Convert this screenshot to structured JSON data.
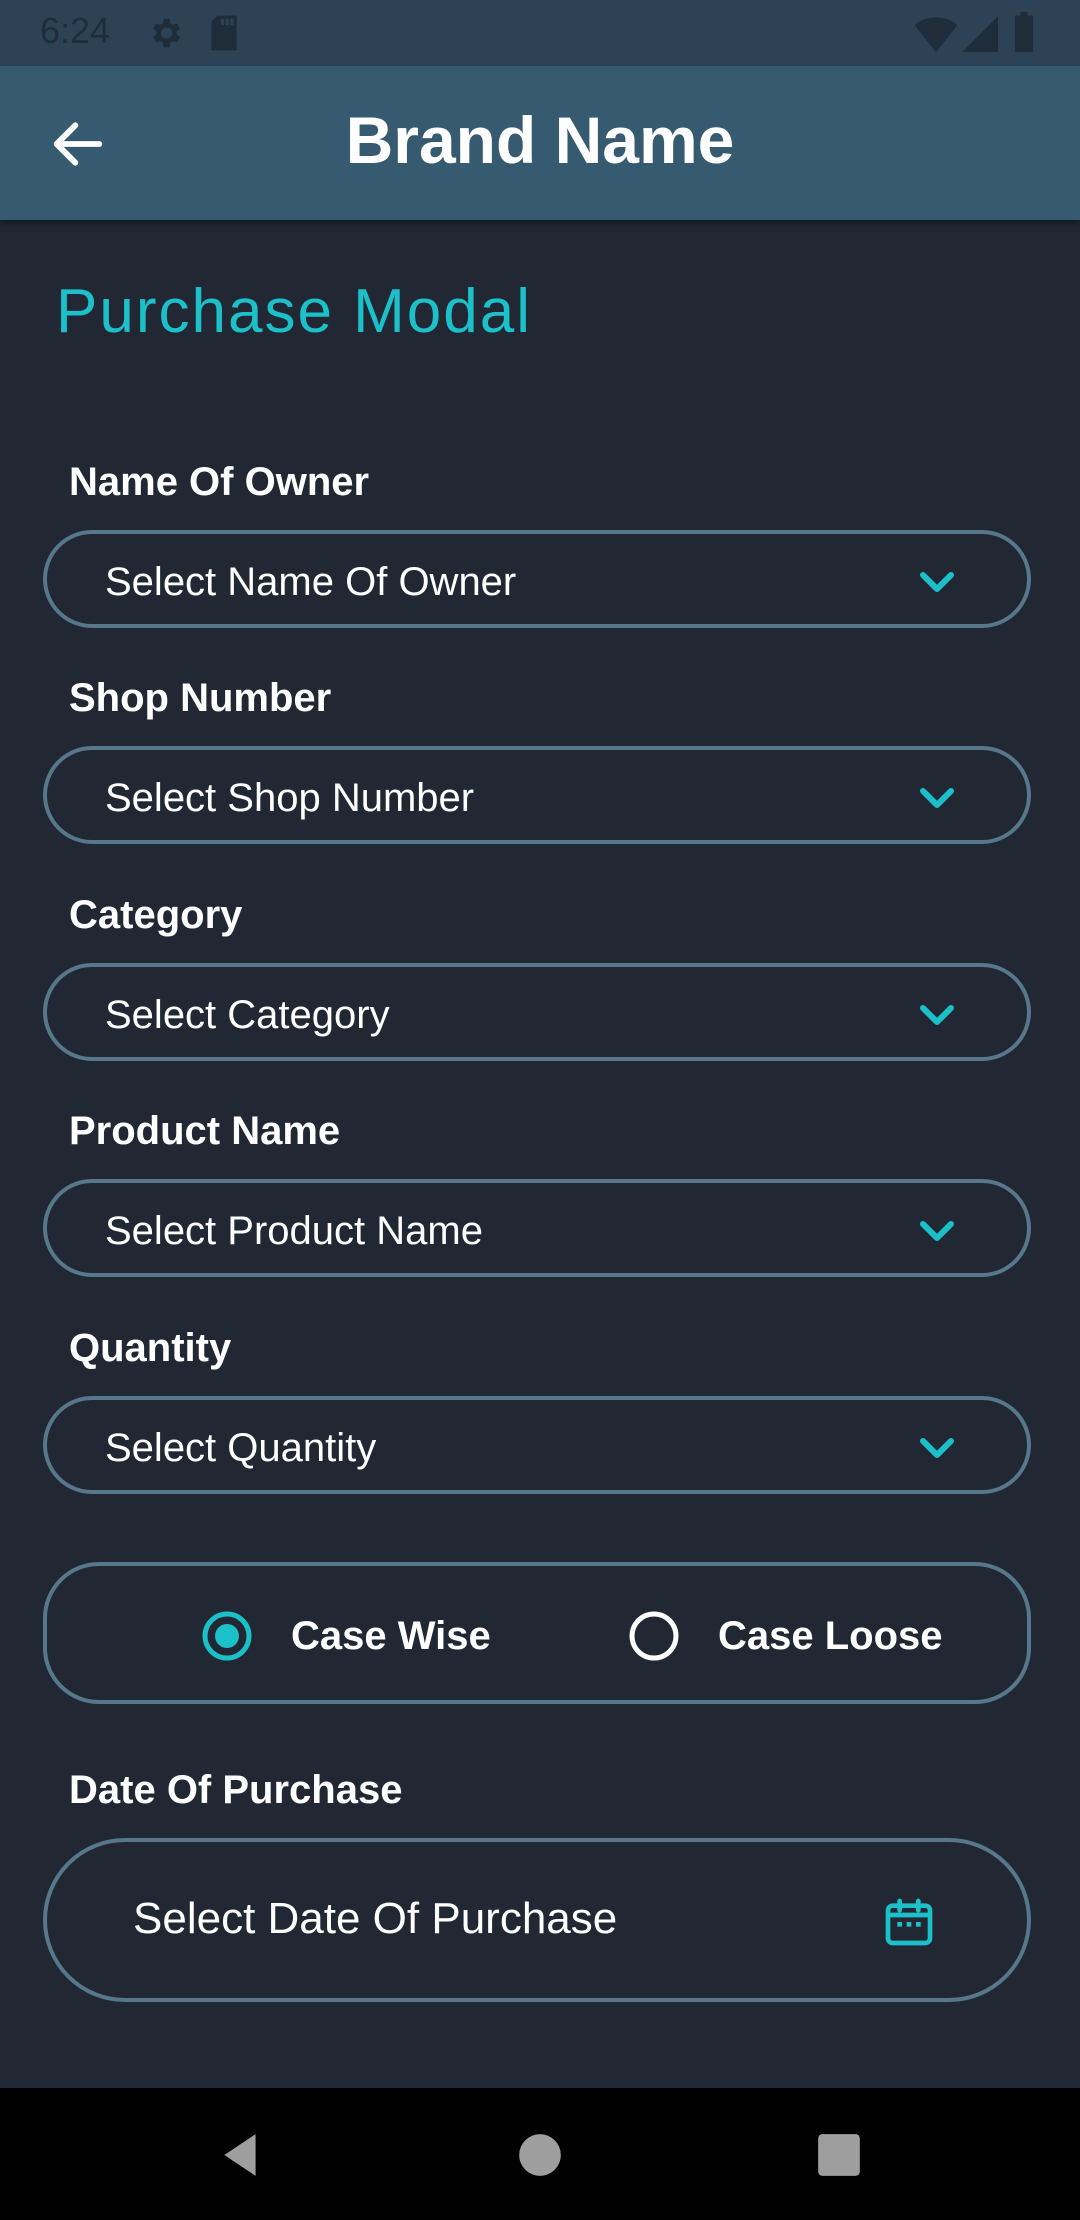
{
  "status_bar": {
    "time": "6:24",
    "icons": [
      "gear-icon",
      "sd-card-icon",
      "wifi-icon",
      "signal-icon",
      "battery-icon"
    ]
  },
  "app_bar": {
    "title": "Brand Name",
    "back_icon": "arrow-back-icon"
  },
  "page": {
    "heading": "Purchase Modal"
  },
  "fields": [
    {
      "label": "Name Of Owner",
      "placeholder": "Select Name Of Owner"
    },
    {
      "label": "Shop Number",
      "placeholder": "Select Shop Number"
    },
    {
      "label": "Category",
      "placeholder": "Select Category"
    },
    {
      "label": "Product Name",
      "placeholder": "Select Product Name"
    },
    {
      "label": "Quantity",
      "placeholder": "Select Quantity"
    }
  ],
  "radio": {
    "options": [
      {
        "label": "Case Wise",
        "selected": true
      },
      {
        "label": "Case Loose",
        "selected": false
      }
    ]
  },
  "date": {
    "label": "Date Of Purchase",
    "placeholder": "Select Date Of Purchase",
    "icon": "calendar-icon"
  },
  "nav_bar": {
    "icons": [
      "back-triangle-icon",
      "home-circle-icon",
      "recents-square-icon"
    ]
  },
  "colors": {
    "background": "#212834",
    "app_bar": "#365a70",
    "status_bar": "#2d4355",
    "accent": "#1cc0c8",
    "border": "#56788a"
  }
}
